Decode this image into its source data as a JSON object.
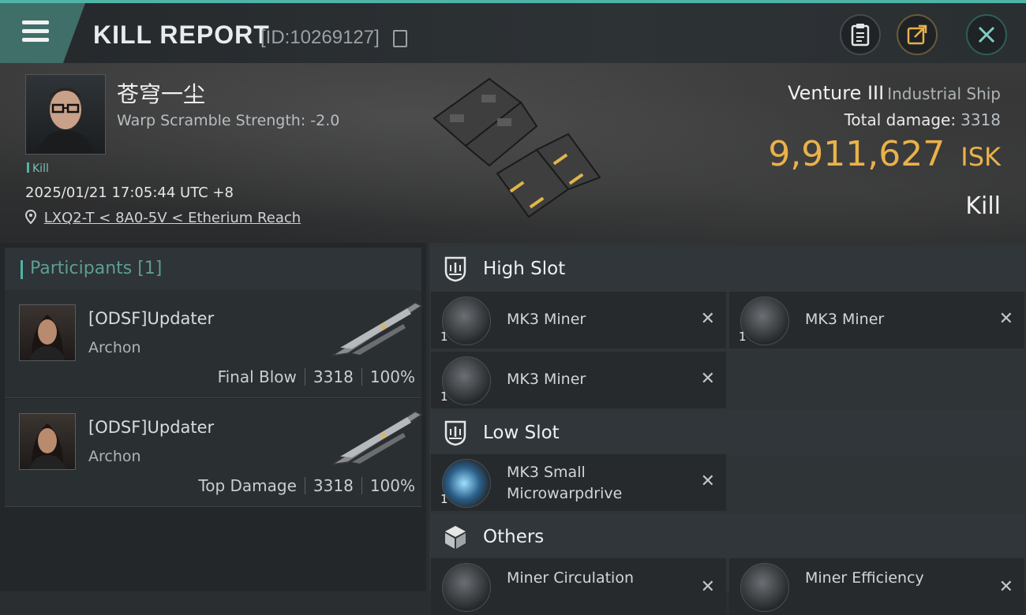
{
  "header": {
    "title": "KILL REPORT",
    "report_id": "[ID:10269127]",
    "icons": [
      "menu-icon",
      "copy-icon",
      "clipboard-icon",
      "share-icon",
      "close-icon"
    ]
  },
  "victim": {
    "pilot_name": "苍穹一尘",
    "warp_scramble": "Warp Scramble Strength: -2.0",
    "tag": "Kill",
    "datetime": "2025/01/21 17:05:44 UTC +8",
    "location": "LXQ2-T < 8A0-5V < Etherium Reach",
    "ship_name": "Venture III",
    "ship_class": "Industrial Ship",
    "total_damage_label": "Total damage:",
    "total_damage": "3318",
    "isk_value": "9,911,627",
    "isk_unit": "ISK",
    "result": "Kill"
  },
  "participants": {
    "header": "Participants [1]",
    "rows": [
      {
        "name": "[ODSF]Updater",
        "ship": "Archon",
        "role": "Final Blow",
        "damage": "3318",
        "percent": "100%"
      },
      {
        "name": "[ODSF]Updater",
        "ship": "Archon",
        "role": "Top Damage",
        "damage": "3318",
        "percent": "100%"
      }
    ]
  },
  "fitting": {
    "high_slot": {
      "label": "High Slot",
      "modules": [
        {
          "name": "MK3 Miner",
          "qty": "1"
        },
        {
          "name": "MK3 Miner",
          "qty": "1"
        },
        {
          "name": "MK3 Miner",
          "qty": "1"
        }
      ]
    },
    "low_slot": {
      "label": "Low Slot",
      "modules": [
        {
          "name": "MK3 Small Microwarpdrive",
          "qty": "1"
        }
      ]
    },
    "others": {
      "label": "Others",
      "modules": [
        {
          "name": "Miner Circulation"
        },
        {
          "name": "Miner Efficiency"
        }
      ]
    }
  },
  "colors": {
    "accent": "#4fb3a6",
    "isk": "#e9b24a",
    "background": "#2a2e31"
  }
}
